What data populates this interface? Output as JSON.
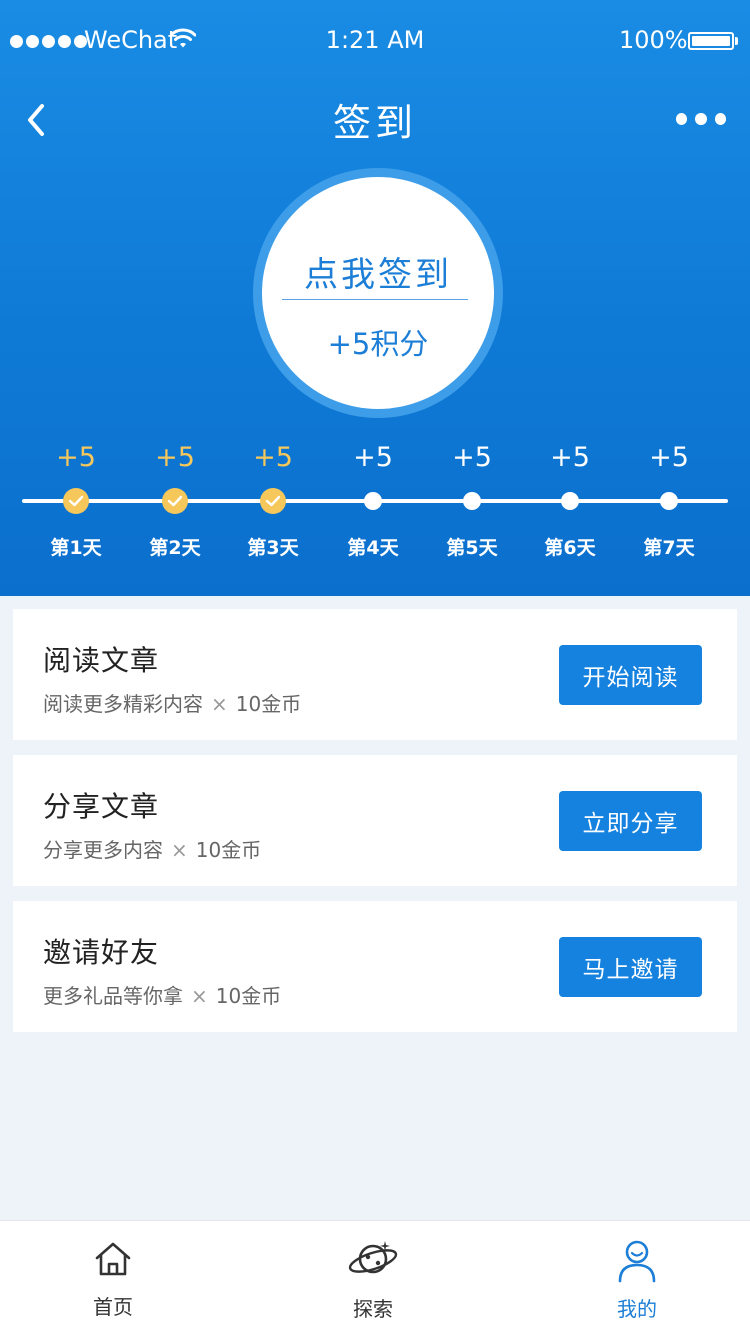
{
  "status_bar": {
    "carrier": "WeChat",
    "time": "1:21 AM",
    "battery": "100%"
  },
  "nav": {
    "title": "签到",
    "back_icon": "chevron-left-icon",
    "more_icon": "more-dots-icon"
  },
  "checkin": {
    "label": "点我签到",
    "points": "+5积分"
  },
  "timeline": {
    "days": [
      {
        "points": "+5",
        "label": "第1天",
        "done": true
      },
      {
        "points": "+5",
        "label": "第2天",
        "done": true
      },
      {
        "points": "+5",
        "label": "第3天",
        "done": true
      },
      {
        "points": "+5",
        "label": "第4天",
        "done": false
      },
      {
        "points": "+5",
        "label": "第5天",
        "done": false
      },
      {
        "points": "+5",
        "label": "第6天",
        "done": false
      },
      {
        "points": "+5",
        "label": "第7天",
        "done": false
      }
    ]
  },
  "tasks": [
    {
      "title": "阅读文章",
      "desc": "阅读更多精彩内容",
      "multiplier": "×",
      "reward": "10金币",
      "button": "开始阅读"
    },
    {
      "title": "分享文章",
      "desc": "分享更多内容",
      "multiplier": "×",
      "reward": "10金币",
      "button": "立即分享"
    },
    {
      "title": "邀请好友",
      "desc": "更多礼品等你拿",
      "multiplier": "×",
      "reward": "10金币",
      "button": "马上邀请"
    }
  ],
  "tabs": [
    {
      "label": "首页",
      "icon": "home-icon",
      "active": false
    },
    {
      "label": "探索",
      "icon": "planet-icon",
      "active": false
    },
    {
      "label": "我的",
      "icon": "user-icon",
      "active": true
    }
  ],
  "colors": {
    "primary": "#1582df",
    "done": "#f6c75b",
    "background": "#eef3fa"
  }
}
